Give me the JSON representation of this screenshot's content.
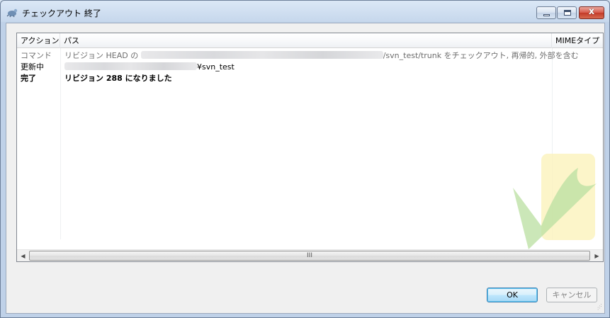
{
  "window": {
    "title": "チェックアウト 終了",
    "close_glyph": "x"
  },
  "listview": {
    "columns": [
      "アクション",
      "パス",
      "MIMEタイプ"
    ],
    "rows": [
      {
        "action": "コマンド",
        "path_prefix": "リビジョン HEAD の",
        "path_suffix": "/svn_test/trunk をチェックアウト, 再帰的, 外部を含む",
        "style": "gray"
      },
      {
        "action": "更新中",
        "path_prefix": "",
        "path_suffix": "¥svn_test",
        "style": "normal"
      },
      {
        "action": "完了",
        "path_prefix": "リビジョン 288 になりました",
        "path_suffix": "",
        "style": "bold"
      }
    ],
    "scrollbar": {
      "left_arrow": "◀",
      "right_arrow": "▶",
      "grip": "III"
    }
  },
  "buttons": {
    "ok": "OK",
    "cancel": "キャンセル"
  },
  "icons": [
    "tortoisesvn-icon",
    "minimize-icon",
    "maximize-icon",
    "close-icon",
    "checkmark-watermark-icon",
    "resize-grip-icon"
  ],
  "colors": {
    "accent": "#3c7fb1",
    "close": "#c23a28",
    "watermark_green": "#b9dfa0",
    "watermark_yellow": "#fbf3bc"
  }
}
